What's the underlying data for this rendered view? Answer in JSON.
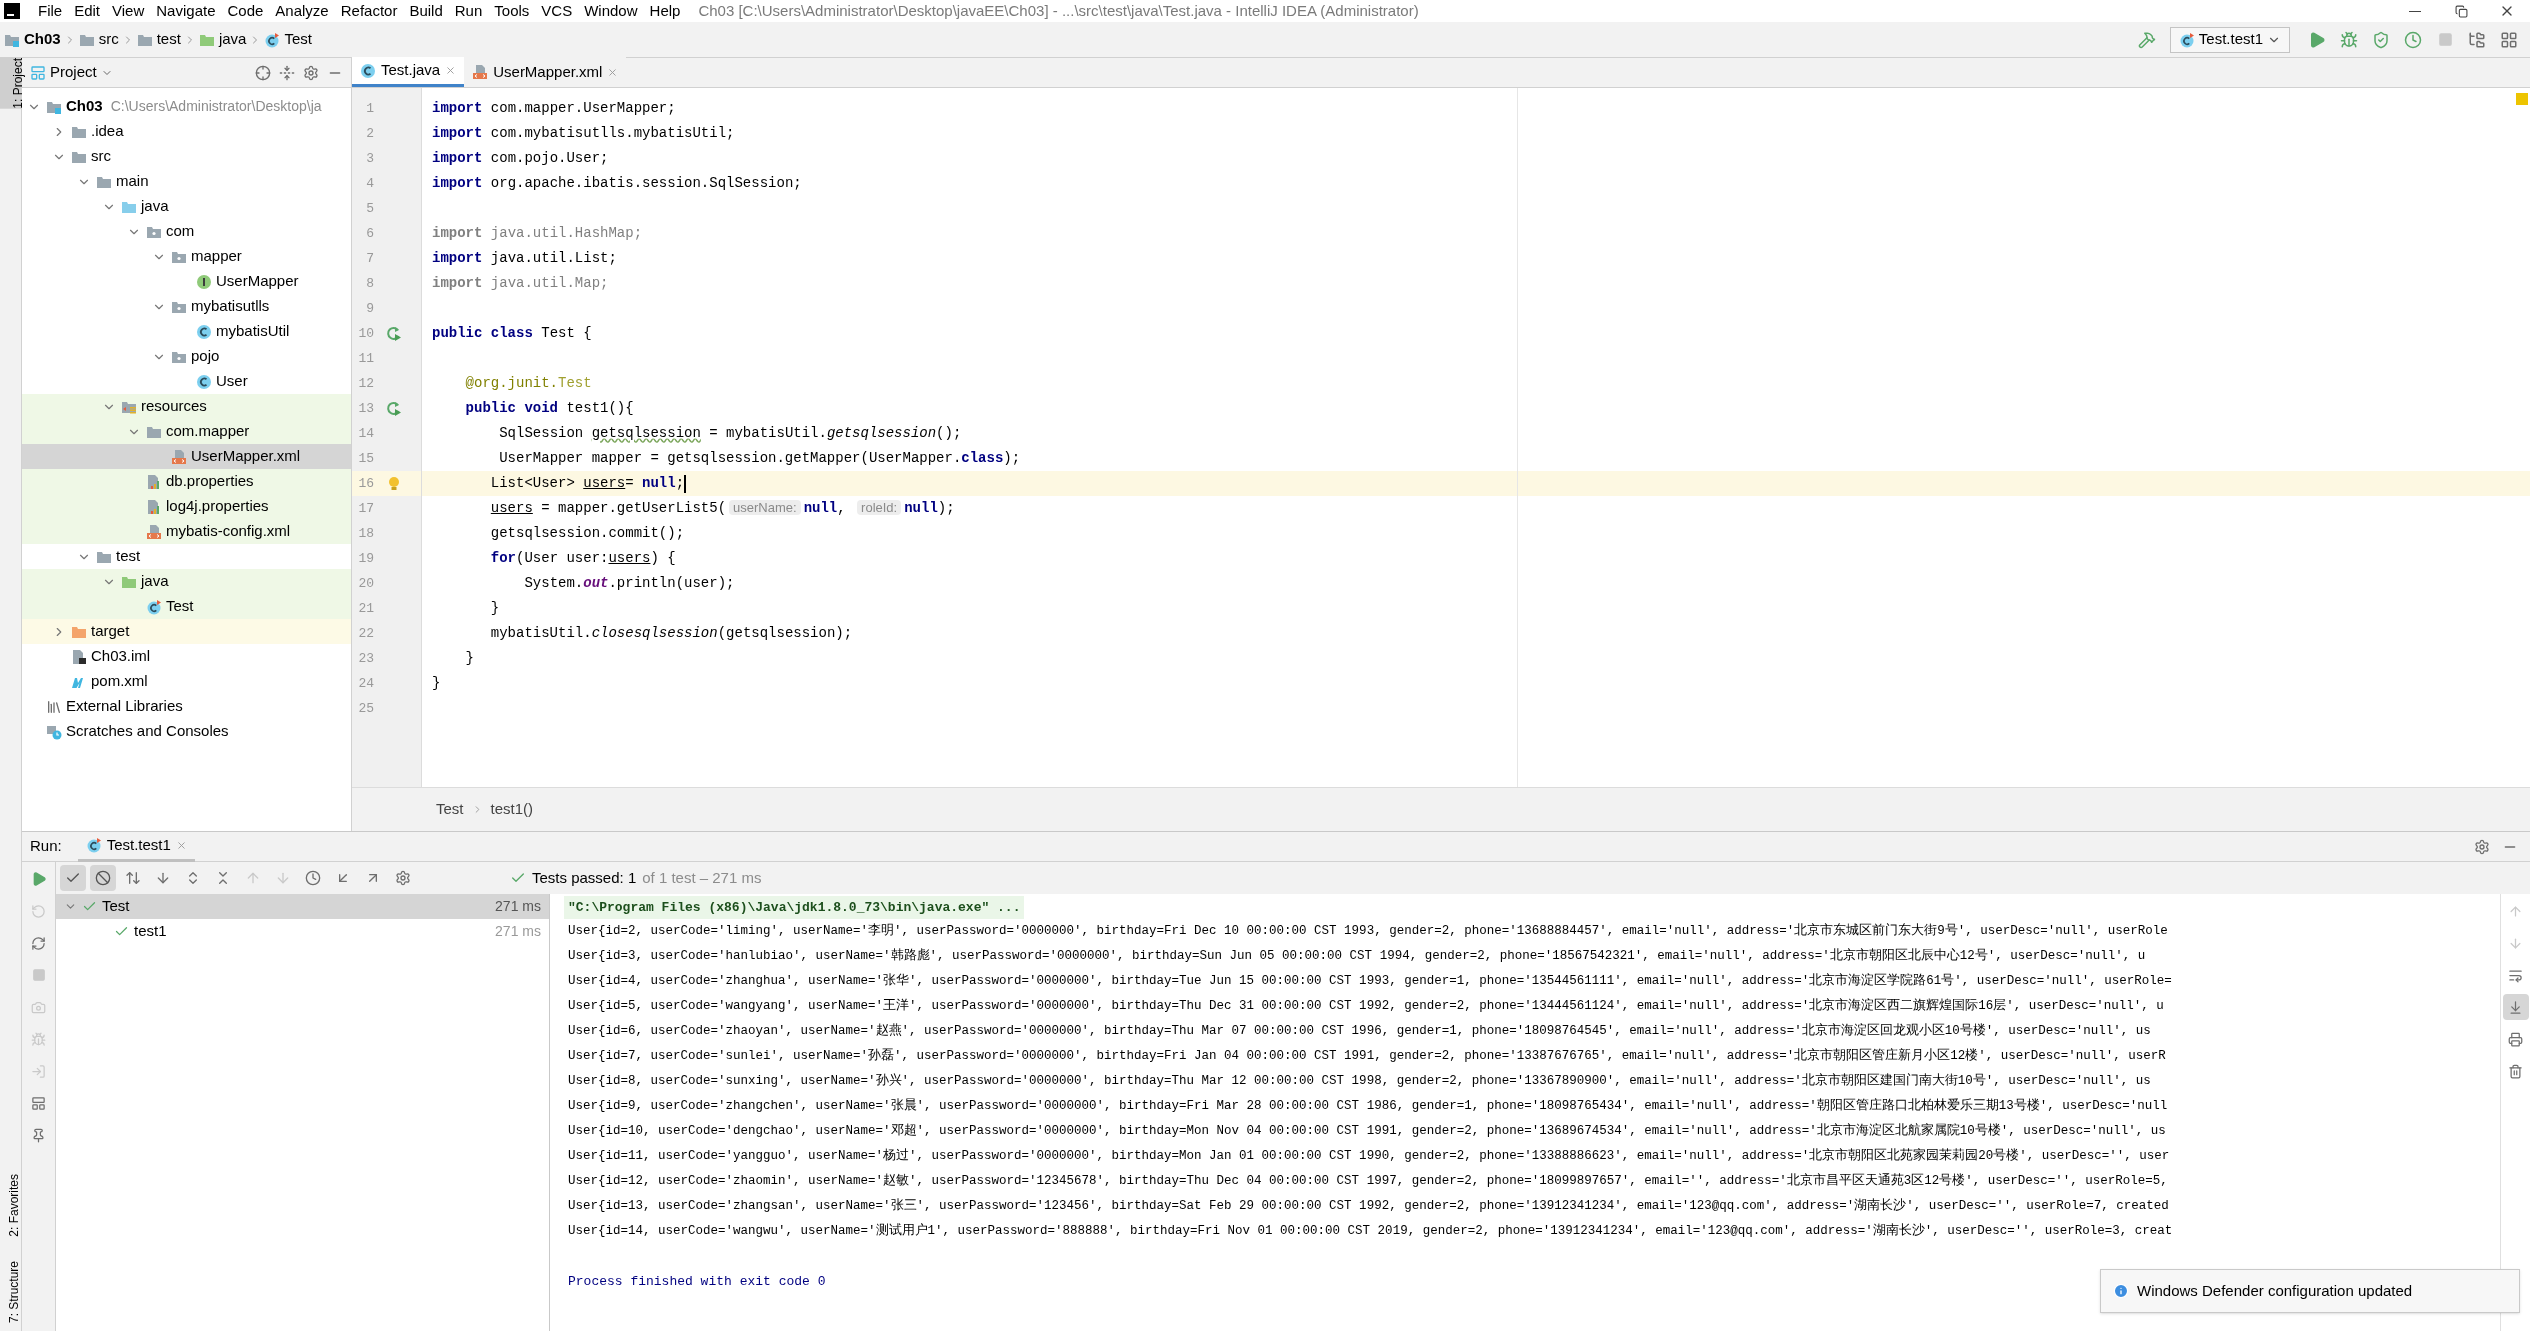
{
  "window": {
    "title": "Ch03 [C:\\Users\\Administrator\\Desktop\\javaEE\\Ch03] - ...\\src\\test\\java\\Test.java - IntelliJ IDEA (Administrator)"
  },
  "menu": [
    "File",
    "Edit",
    "View",
    "Navigate",
    "Code",
    "Analyze",
    "Refactor",
    "Build",
    "Run",
    "Tools",
    "VCS",
    "Window",
    "Help"
  ],
  "nav_bar": {
    "breadcrumbs": [
      {
        "label": "Ch03",
        "kind": "module"
      },
      {
        "label": "src",
        "kind": "folder"
      },
      {
        "label": "test",
        "kind": "folder"
      },
      {
        "label": "java",
        "kind": "test-folder"
      },
      {
        "label": "Test",
        "kind": "test-class"
      }
    ],
    "run_config": "Test.test1"
  },
  "side_stripe": {
    "top": [
      "1: Project"
    ],
    "bottom": [
      "2: Favorites",
      "7: Structure"
    ]
  },
  "project_panel": {
    "title": "Project",
    "tree": [
      {
        "name": "Ch03",
        "note": "C:\\Users\\Administrator\\Desktop\\ja",
        "kind": "module",
        "expanded": true,
        "selected": false,
        "children": [
          {
            "name": ".idea",
            "kind": "folder",
            "expanded": false,
            "selected": false
          },
          {
            "name": "src",
            "kind": "folder",
            "expanded": true,
            "selected": false,
            "children": [
              {
                "name": "main",
                "kind": "folder",
                "expanded": true,
                "selected": false,
                "children": [
                  {
                    "name": "java",
                    "kind": "source-folder",
                    "expanded": true,
                    "selected": false,
                    "children": [
                      {
                        "name": "com",
                        "kind": "package",
                        "expanded": true,
                        "selected": false,
                        "children": [
                          {
                            "name": "mapper",
                            "kind": "package",
                            "expanded": true,
                            "selected": false,
                            "children": [
                              {
                                "name": "UserMapper",
                                "kind": "interface",
                                "selected": false
                              }
                            ]
                          },
                          {
                            "name": "mybatisutlls",
                            "kind": "package",
                            "expanded": true,
                            "selected": false,
                            "children": [
                              {
                                "name": "mybatisUtil",
                                "kind": "class",
                                "selected": false
                              }
                            ]
                          },
                          {
                            "name": "pojo",
                            "kind": "package",
                            "expanded": true,
                            "selected": false,
                            "children": [
                              {
                                "name": "User",
                                "kind": "class",
                                "selected": false
                              }
                            ]
                          }
                        ]
                      }
                    ]
                  },
                  {
                    "name": "resources",
                    "kind": "resources",
                    "color": "#eff8e6",
                    "expanded": true,
                    "selected": false,
                    "children": [
                      {
                        "name": "com.mapper",
                        "kind": "folder",
                        "color": "#eff8e6",
                        "expanded": true,
                        "selected": false,
                        "children": [
                          {
                            "name": "UserMapper.xml",
                            "kind": "xml",
                            "selected": true
                          }
                        ]
                      },
                      {
                        "name": "db.properties",
                        "kind": "properties",
                        "color": "#eff8e6",
                        "selected": false
                      },
                      {
                        "name": "log4j.properties",
                        "kind": "properties",
                        "color": "#eff8e6",
                        "selected": false
                      },
                      {
                        "name": "mybatis-config.xml",
                        "kind": "xml",
                        "color": "#eff8e6",
                        "selected": false
                      }
                    ]
                  }
                ]
              },
              {
                "name": "test",
                "kind": "folder",
                "expanded": true,
                "selected": false,
                "children": [
                  {
                    "name": "java",
                    "kind": "test-folder",
                    "color": "#eff8e6",
                    "expanded": true,
                    "selected": false,
                    "children": [
                      {
                        "name": "Test",
                        "kind": "test-class",
                        "color": "#eff8e6",
                        "selected": false
                      }
                    ]
                  }
                ]
              }
            ]
          },
          {
            "name": "target",
            "kind": "excluded-folder",
            "color": "#fdfae6",
            "expanded": false,
            "selected": false
          },
          {
            "name": "Ch03.iml",
            "kind": "iml",
            "selected": false
          },
          {
            "name": "pom.xml",
            "kind": "maven",
            "selected": false
          }
        ]
      },
      {
        "name": "External Libraries",
        "kind": "libraries",
        "selected": false
      },
      {
        "name": "Scratches and Consoles",
        "kind": "scratches",
        "selected": false
      }
    ]
  },
  "editor": {
    "tabs": [
      {
        "label": "Test.java",
        "kind": "class",
        "selected": true
      },
      {
        "label": "UserMapper.xml",
        "kind": "xml",
        "selected": false
      }
    ],
    "lines": [
      {
        "n": "1",
        "tokens": [
          {
            "t": "import",
            "kind": "kw"
          },
          {
            "t": " com.mapper.UserMapper;",
            "kind": "plain"
          }
        ]
      },
      {
        "n": "2",
        "tokens": [
          {
            "t": "import",
            "kind": "kw"
          },
          {
            "t": " com.mybatisutlls.mybatisUtil;",
            "kind": "plain"
          }
        ]
      },
      {
        "n": "3",
        "tokens": [
          {
            "t": "import",
            "kind": "kw"
          },
          {
            "t": " com.pojo.User;",
            "kind": "plain"
          }
        ]
      },
      {
        "n": "4",
        "tokens": [
          {
            "t": "import",
            "kind": "kw"
          },
          {
            "t": " org.apache.ibatis.session.SqlSession;",
            "kind": "plain"
          }
        ]
      },
      {
        "n": "5"
      },
      {
        "n": "6",
        "tokens": [
          {
            "t": "import",
            "kind": "unused-kw"
          },
          {
            "t": " java.util.HashMap;",
            "kind": "unused"
          }
        ]
      },
      {
        "n": "7",
        "tokens": [
          {
            "t": "import",
            "kind": "kw"
          },
          {
            "t": " java.util.List;",
            "kind": "plain"
          }
        ]
      },
      {
        "n": "8",
        "tokens": [
          {
            "t": "import",
            "kind": "unused-kw"
          },
          {
            "t": " java.util.Map;",
            "kind": "unused"
          }
        ]
      },
      {
        "n": "9"
      },
      {
        "n": "10",
        "gutter": {
          "kind": "run"
        },
        "tokens": [
          {
            "t": "public class",
            "kind": "kw"
          },
          {
            "t": " Test {",
            "kind": "plain"
          }
        ]
      },
      {
        "n": "11"
      },
      {
        "n": "12",
        "tokens": [
          {
            "t": "    @org.junit.",
            "kind": "ann"
          },
          {
            "t": "Test",
            "kind": "ann-name"
          }
        ]
      },
      {
        "n": "13",
        "gutter": {
          "kind": "run"
        },
        "tokens": [
          {
            "t": "    public void",
            "kind": "kw"
          },
          {
            "t": " test1(){",
            "kind": "plain"
          }
        ]
      },
      {
        "n": "14",
        "tokens": [
          {
            "t": "        SqlSession ",
            "kind": "plain"
          },
          {
            "t": "getsqlsession",
            "kind": "typo"
          },
          {
            "t": " = mybatisUtil.",
            "kind": "plain"
          },
          {
            "t": "getsqlsession",
            "kind": "static"
          },
          {
            "t": "();",
            "kind": "plain"
          }
        ]
      },
      {
        "n": "15",
        "tokens": [
          {
            "t": "        UserMapper mapper = getsqlsession.getMapper(UserMapper.",
            "kind": "plain"
          },
          {
            "t": "class",
            "kind": "kw"
          },
          {
            "t": ");",
            "kind": "plain"
          }
        ]
      },
      {
        "n": "16",
        "gutter": {
          "kind": "bulb"
        },
        "current": true,
        "tokens": [
          {
            "t": "       List<User> ",
            "kind": "plain"
          },
          {
            "t": "users",
            "kind": "reassigned"
          },
          {
            "t": "= ",
            "kind": "plain"
          },
          {
            "t": "null",
            "kind": "kw"
          },
          {
            "t": ";",
            "kind": "plain"
          }
        ]
      },
      {
        "n": "17",
        "tokens": [
          {
            "t": "       users",
            "kind": "reassigned"
          },
          {
            "t": " = mapper.getUserList5(",
            "kind": "plain"
          },
          {
            "t": "userName:",
            "kind": "hint"
          },
          {
            "t": "null",
            "kind": "kw"
          },
          {
            "t": ", ",
            "kind": "plain"
          },
          {
            "t": "roleId:",
            "kind": "hint"
          },
          {
            "t": "null",
            "kind": "kw"
          },
          {
            "t": ");",
            "kind": "plain"
          }
        ]
      },
      {
        "n": "18",
        "tokens": [
          {
            "t": "       getsqlsession.commit();",
            "kind": "plain"
          }
        ]
      },
      {
        "n": "19",
        "tokens": [
          {
            "t": "       for",
            "kind": "kw"
          },
          {
            "t": "(User user:",
            "kind": "plain"
          },
          {
            "t": "users",
            "kind": "reassigned"
          },
          {
            "t": ") {",
            "kind": "plain"
          }
        ]
      },
      {
        "n": "20",
        "tokens": [
          {
            "t": "           System.",
            "kind": "plain"
          },
          {
            "t": "out",
            "kind": "field"
          },
          {
            "t": ".println(user);",
            "kind": "plain"
          }
        ]
      },
      {
        "n": "21",
        "tokens": [
          {
            "t": "       }",
            "kind": "plain"
          }
        ]
      },
      {
        "n": "22",
        "tokens": [
          {
            "t": "       mybatisUtil.",
            "kind": "plain"
          },
          {
            "t": "closesqlsession",
            "kind": "static"
          },
          {
            "t": "(getsqlsession);",
            "kind": "plain"
          }
        ]
      },
      {
        "n": "23",
        "tokens": [
          {
            "t": "    }",
            "kind": "plain"
          }
        ]
      },
      {
        "n": "24",
        "tokens": [
          {
            "t": "}",
            "kind": "plain"
          }
        ]
      },
      {
        "n": "25"
      }
    ],
    "breadcrumbs": [
      "Test",
      "test1()"
    ]
  },
  "run_panel": {
    "label": "Run:",
    "tab": "Test.test1",
    "toggles": [
      {
        "kind": "passed",
        "on": true
      },
      {
        "kind": "ignored",
        "on": true
      }
    ],
    "status": {
      "label": "Tests passed: 1",
      "detail": "of 1 test – 271 ms"
    },
    "tests": [
      {
        "name": "Test",
        "time": "271 ms",
        "selected": true,
        "children": [
          {
            "name": "test1",
            "time": "271 ms",
            "selected": false
          }
        ]
      }
    ],
    "console": {
      "command": "\"C:\\Program Files (x86)\\Java\\jdk1.8.0_73\\bin\\java.exe\" ...",
      "output": [
        "User{id=2, userCode='liming', userName='李明', userPassword='0000000', birthday=Fri Dec 10 00:00:00 CST 1993, gender=2, phone='13688884457', email='null', address='北京市东城区前门东大街9号', userDesc='null', userRole",
        "User{id=3, userCode='hanlubiao', userName='韩路彪', userPassword='0000000', birthday=Sun Jun 05 00:00:00 CST 1994, gender=2, phone='18567542321', email='null', address='北京市朝阳区北辰中心12号', userDesc='null', u",
        "User{id=4, userCode='zhanghua', userName='张华', userPassword='0000000', birthday=Tue Jun 15 00:00:00 CST 1993, gender=1, phone='13544561111', email='null', address='北京市海淀区学院路61号', userDesc='null', userRole=",
        "User{id=5, userCode='wangyang', userName='王洋', userPassword='0000000', birthday=Thu Dec 31 00:00:00 CST 1992, gender=2, phone='13444561124', email='null', address='北京市海淀区西二旗辉煌国际16层', userDesc='null', u",
        "User{id=6, userCode='zhaoyan', userName='赵燕', userPassword='0000000', birthday=Thu Mar 07 00:00:00 CST 1996, gender=1, phone='18098764545', email='null', address='北京市海淀区回龙观小区10号楼', userDesc='null', us",
        "User{id=7, userCode='sunlei', userName='孙磊', userPassword='0000000', birthday=Fri Jan 04 00:00:00 CST 1991, gender=2, phone='13387676765', email='null', address='北京市朝阳区管庄新月小区12楼', userDesc='null', userR",
        "User{id=8, userCode='sunxing', userName='孙兴', userPassword='0000000', birthday=Thu Mar 12 00:00:00 CST 1998, gender=2, phone='13367890900', email='null', address='北京市朝阳区建国门南大街10号', userDesc='null', us",
        "User{id=9, userCode='zhangchen', userName='张晨', userPassword='0000000', birthday=Fri Mar 28 00:00:00 CST 1986, gender=1, phone='18098765434', email='null', address='朝阳区管庄路口北柏林爱乐三期13号楼', userDesc='null",
        "User{id=10, userCode='dengchao', userName='邓超', userPassword='0000000', birthday=Mon Nov 04 00:00:00 CST 1991, gender=2, phone='13689674534', email='null', address='北京市海淀区北航家属院10号楼', userDesc='null', us",
        "User{id=11, userCode='yangguo', userName='杨过', userPassword='0000000', birthday=Mon Jan 01 00:00:00 CST 1990, gender=2, phone='13388886623', email='null', address='北京市朝阳区北苑家园茉莉园20号楼', userDesc='', user",
        "User{id=12, userCode='zhaomin', userName='赵敏', userPassword='12345678', birthday=Thu Dec 04 00:00:00 CST 1997, gender=2, phone='18099897657', email='', address='北京市昌平区天通苑3区12号楼', userDesc='', userRole=5,",
        "User{id=13, userCode='zhangsan', userName='张三', userPassword='123456', birthday=Sat Feb 29 00:00:00 CST 1992, gender=2, phone='13912341234', email='123@qq.com', address='湖南长沙', userDesc='', userRole=7, created",
        "User{id=14, userCode='wangwu', userName='测试用户1', userPassword='888888', birthday=Fri Nov 01 00:00:00 CST 2019, gender=2, phone='13912341234', email='123@qq.com', address='湖南长沙', userDesc='', userRole=3, creat"
      ],
      "exit": "Process finished with exit code 0"
    }
  },
  "notification": {
    "text": "Windows Defender configuration updated"
  }
}
